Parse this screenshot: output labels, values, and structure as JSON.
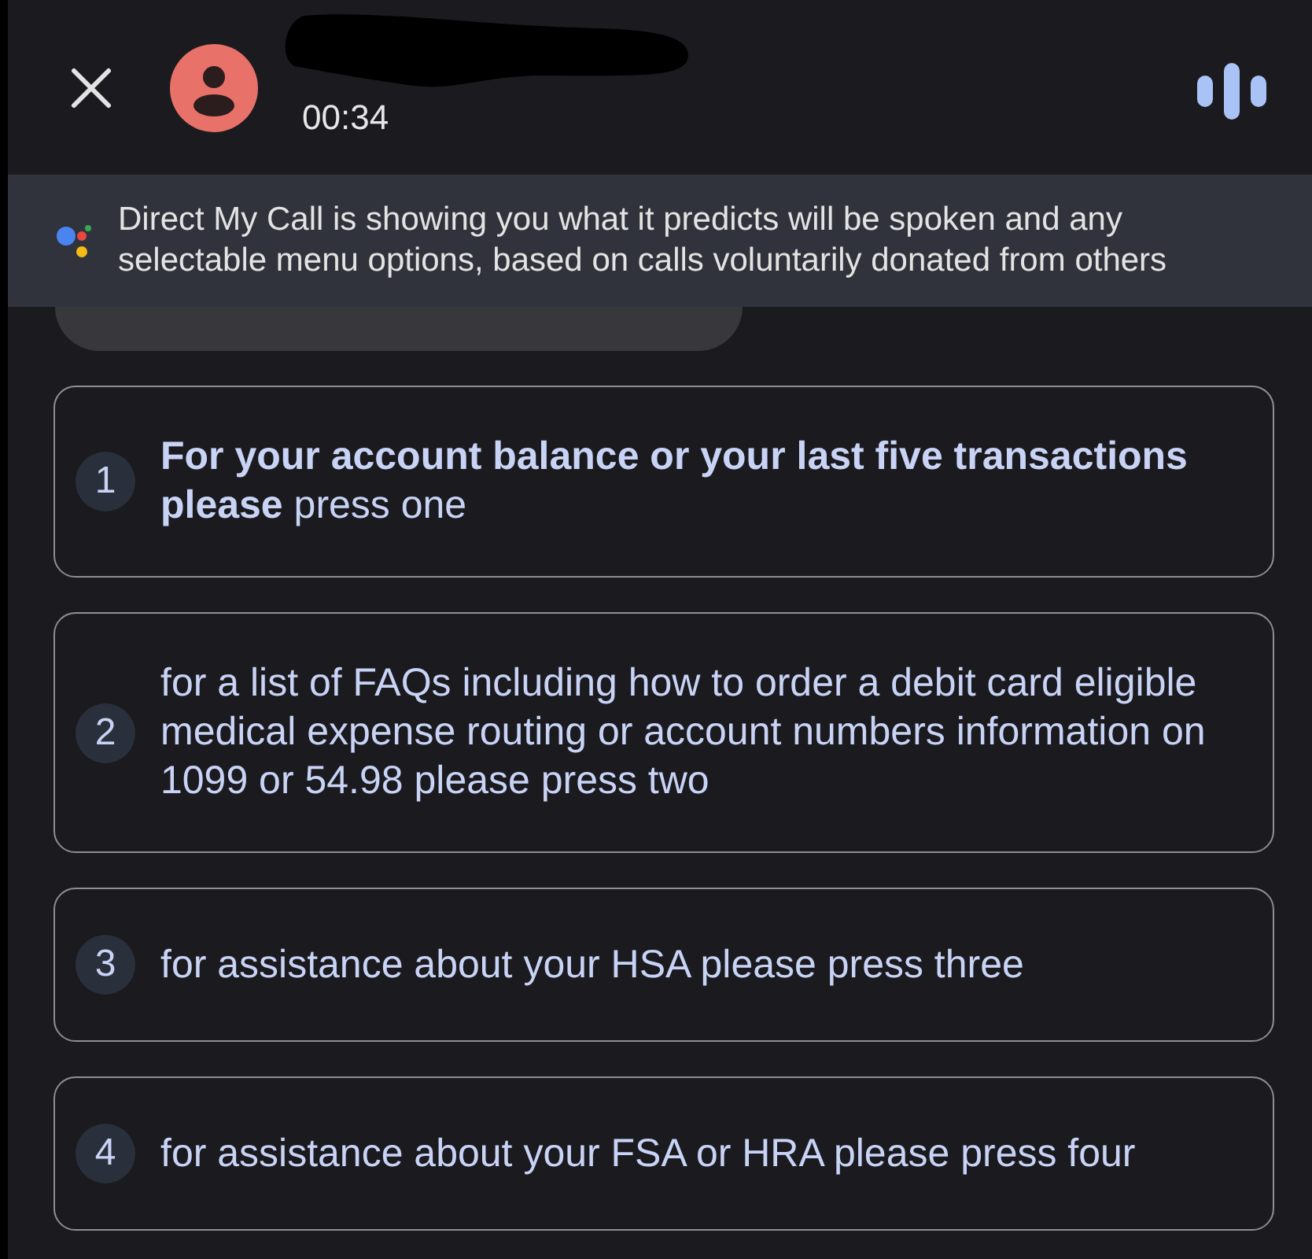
{
  "call_header": {
    "timer": "00:34"
  },
  "banner": {
    "text": "Direct My Call is showing you what it predicts will be spoken and any selectable menu options, based on calls voluntarily donated from others"
  },
  "menu_options": [
    {
      "number": "1",
      "text": "**For your account balance or your last five transactions please** press one"
    },
    {
      "number": "2",
      "text": "for a list of FAQs including how to order a debit card eligible medical expense routing or account numbers information on 1099 or 54.98 please press two"
    },
    {
      "number": "3",
      "text": "for assistance about your HSA please press three"
    },
    {
      "number": "4",
      "text": "for assistance about your FSA or HRA please press four"
    }
  ]
}
